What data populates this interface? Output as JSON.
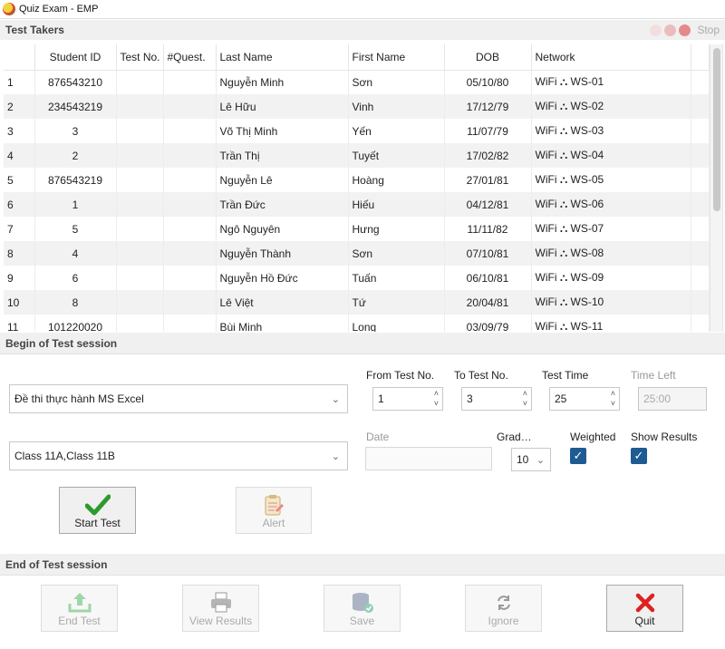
{
  "window": {
    "title": "Quiz Exam - EMP"
  },
  "test_takers": {
    "header": "Test Takers",
    "stop_label": "Stop",
    "dot_colors": [
      "#f2dede",
      "#ecbcbc",
      "#e48a8a"
    ],
    "columns": [
      "",
      "Student ID",
      "Test No.",
      "#Quest.",
      "Last Name",
      "First Name",
      "DOB",
      "Network"
    ],
    "rows": [
      [
        "1",
        "876543210",
        "",
        "",
        "Nguyễn Minh",
        "Sơn",
        "05/10/80",
        "WiFi ⛬ WS-01"
      ],
      [
        "2",
        "234543219",
        "",
        "",
        "Lê Hữu",
        "Vinh",
        "17/12/79",
        "WiFi ⛬ WS-02"
      ],
      [
        "3",
        "3",
        "",
        "",
        "Võ Thị Minh",
        "Yến",
        "11/07/79",
        "WiFi ⛬ WS-03"
      ],
      [
        "4",
        "2",
        "",
        "",
        "Trần Thị",
        "Tuyết",
        "17/02/82",
        "WiFi ⛬ WS-04"
      ],
      [
        "5",
        "876543219",
        "",
        "",
        "Nguyễn Lê",
        "Hoàng",
        "27/01/81",
        "WiFi ⛬ WS-05"
      ],
      [
        "6",
        "1",
        "",
        "",
        "Trần Đức",
        "Hiếu",
        "04/12/81",
        "WiFi ⛬ WS-06"
      ],
      [
        "7",
        "5",
        "",
        "",
        "Ngô Nguyên",
        "Hưng",
        "11/11/82",
        "WiFi ⛬ WS-07"
      ],
      [
        "8",
        "4",
        "",
        "",
        "Nguyễn Thành",
        "Sơn",
        "07/10/81",
        "WiFi ⛬ WS-08"
      ],
      [
        "9",
        "6",
        "",
        "",
        "Nguyễn Hồ Đức",
        "Tuấn",
        "06/10/81",
        "WiFi ⛬ WS-09"
      ],
      [
        "10",
        "8",
        "",
        "",
        "Lê Việt",
        "Tứ",
        "20/04/81",
        "WiFi ⛬ WS-10"
      ],
      [
        "11",
        "101220020",
        "",
        "",
        "Bùi Minh",
        "Long",
        "03/09/79",
        "WiFi ⛬ WS-11"
      ]
    ]
  },
  "begin": {
    "header": "Begin of Test session",
    "exam_select": "Đề thi thực hành MS Excel",
    "class_select": "Class 11A,Class 11B",
    "from_label": "From Test No.",
    "from_value": "1",
    "to_label": "To Test No.",
    "to_value": "3",
    "time_label": "Test Time",
    "time_value": "25",
    "time_left_label": "Time Left",
    "time_left_value": "25:00",
    "date_label": "Date",
    "grade_label": "Grad…",
    "grade_value": "10",
    "weighted_label": "Weighted",
    "weighted_checked": true,
    "show_results_label": "Show Results",
    "show_results_checked": true,
    "start_label": "Start Test",
    "alert_label": "Alert",
    "check_color": "#2e9a2e",
    "checkbox_color": "#1f5b93"
  },
  "end": {
    "header": "End of Test session",
    "end_test_label": "End Test",
    "view_results_label": "View Results",
    "save_label": "Save",
    "ignore_label": "Ignore",
    "quit_label": "Quit",
    "quit_color": "#e02020"
  }
}
